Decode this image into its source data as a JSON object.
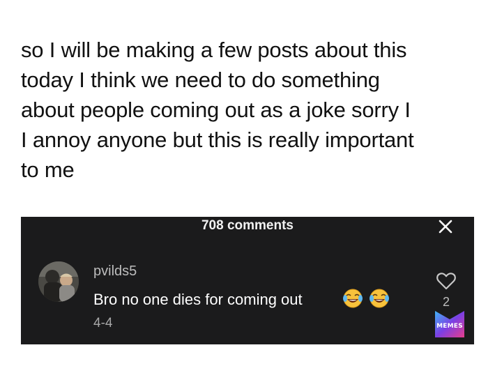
{
  "caption": {
    "lines": [
      "so I will be making a few posts about this",
      "today I think we need to do something",
      "about people coming out as a joke sorry I",
      "I annoy anyone but this is really important",
      "to me"
    ]
  },
  "comments_panel": {
    "title": "708 comments",
    "close_icon": "close-icon",
    "comment": {
      "username": "pvilds5",
      "text": "Bro no one dies for coming out",
      "emoji": "face-with-tears-of-joy x2",
      "date": "4-4",
      "like_count": "2",
      "like_icon": "heart-outline-icon"
    }
  },
  "watermark": {
    "label": "MEMES",
    "colors": [
      "#7b3fe4",
      "#3fb4f5",
      "#e63e8c"
    ]
  }
}
